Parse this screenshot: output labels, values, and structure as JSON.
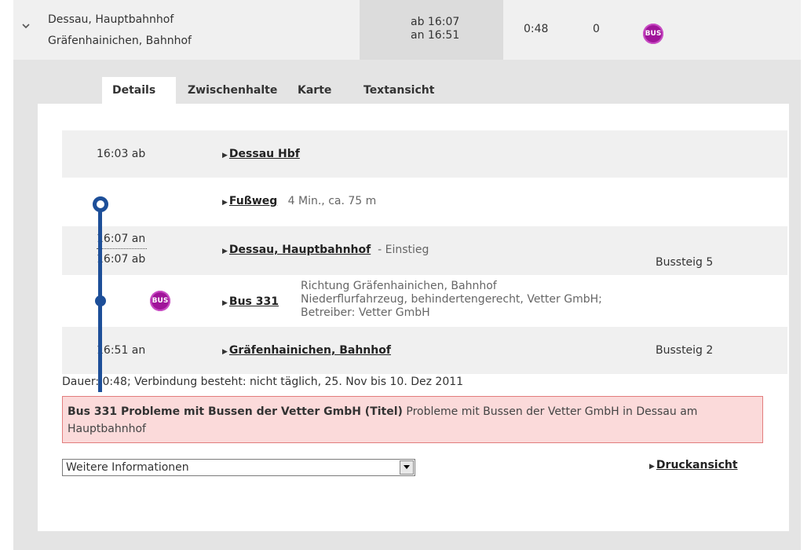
{
  "summary": {
    "from": "Dessau, Hauptbahnhof",
    "to": "Gräfenhainichen, Bahnhof",
    "dep": "ab 16:07",
    "arr": "an 16:51",
    "duration": "0:48",
    "changes": "0",
    "product": "BUS"
  },
  "tabs": {
    "details": "Details",
    "zwischenhalte": "Zwischenhalte",
    "karte": "Karte",
    "textansicht": "Textansicht"
  },
  "route": {
    "stop1": {
      "time": "16:03 ab",
      "name": "Dessau Hbf"
    },
    "walk": {
      "label": "Fußweg",
      "detail": "4 Min., ca. 75 m"
    },
    "stop2": {
      "time_arr": "16:07 an",
      "time_dep": "16:07 ab",
      "name": "Dessau, Hauptbahnhof",
      "suffix": "- Einstieg",
      "platform": "Bussteig 5"
    },
    "bus": {
      "badge": "BUS",
      "label": "Bus 331",
      "line1": "Richtung Gräfenhainichen, Bahnhof",
      "line2": "Niederflurfahrzeug, behindertengerecht, Vetter GmbH;",
      "line3": "Betreiber: Vetter GmbH"
    },
    "stop3": {
      "time": "16:51 an",
      "name": "Gräfenhainichen, Bahnhof",
      "platform": "Bussteig 2"
    }
  },
  "info": "Dauer: 0:48; Verbindung besteht: nicht täglich, 25. Nov bis 10. Dez 2011",
  "notice": {
    "title": "Bus 331   Probleme mit Bussen der Vetter GmbH (Titel)",
    "text": " Probleme mit Bussen der Vetter GmbH in Dessau am Hauptbahnhof"
  },
  "more_info": {
    "selected": "Weitere Informationen"
  },
  "print": {
    "label": "Druckansicht"
  },
  "colors": {
    "track": "#1d4f99",
    "bus_badge": "#a0159a",
    "notice_bg": "#fbdada"
  }
}
